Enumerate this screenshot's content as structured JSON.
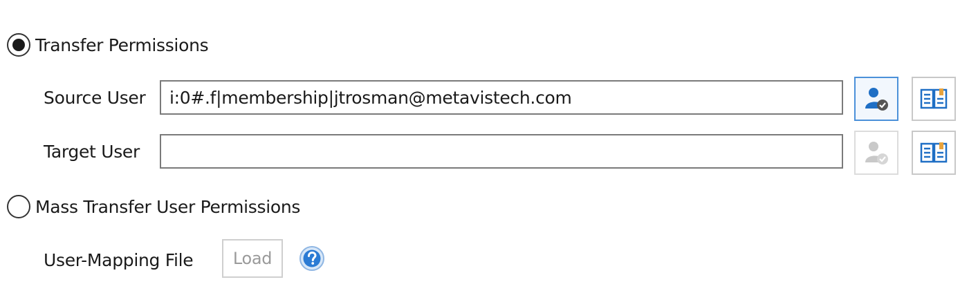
{
  "transfer_permissions": {
    "label": "Transfer Permissions",
    "selected": true,
    "source_user": {
      "label": "Source User",
      "value": "i:0#.f|membership|jtrosman@metavistech.com",
      "people_picker_icon": "user-check-icon",
      "address_book_icon": "address-book-icon"
    },
    "target_user": {
      "label": "Target User",
      "value": "",
      "people_picker_icon": "user-check-icon",
      "address_book_icon": "address-book-icon"
    }
  },
  "mass_transfer": {
    "label": "Mass Transfer User Permissions",
    "selected": false,
    "mapping_file_label": "User-Mapping File",
    "load_label": "Load",
    "help_icon": "help-icon"
  },
  "colors": {
    "accent": "#1f6fc5",
    "help": "#2b7bd4",
    "disabled": "#bdbdbd"
  }
}
